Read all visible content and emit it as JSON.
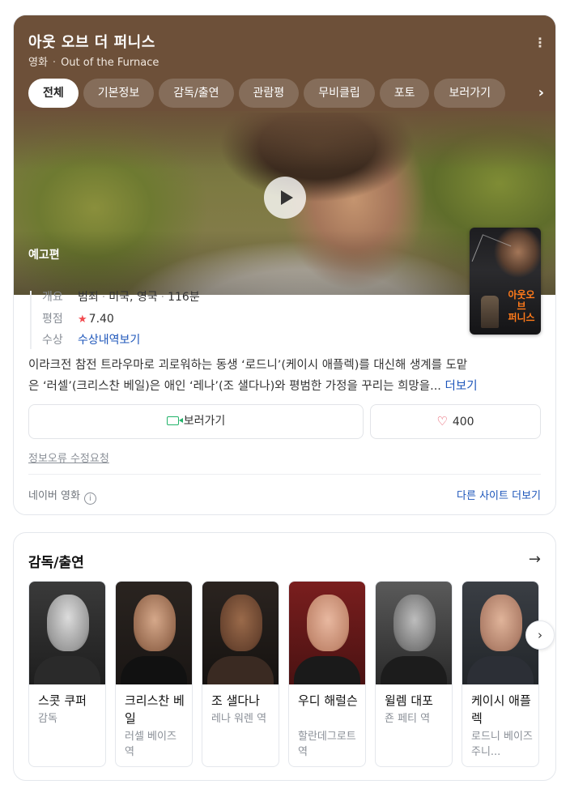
{
  "movie": {
    "title": "아웃 오브 더 퍼니스",
    "category": "영화",
    "original_title": "Out of the Furnace",
    "more_icon": "vertical-ellipsis-icon"
  },
  "tabs": [
    {
      "label": "전체",
      "active": true
    },
    {
      "label": "기본정보",
      "active": false
    },
    {
      "label": "감독/출연",
      "active": false
    },
    {
      "label": "관람평",
      "active": false
    },
    {
      "label": "무비클립",
      "active": false
    },
    {
      "label": "포토",
      "active": false
    },
    {
      "label": "보러가기",
      "active": false
    }
  ],
  "trailer": {
    "label": "예고편"
  },
  "info": {
    "overview_label": "개요",
    "genre": "범죄",
    "country": "미국, 영국",
    "runtime": "116분",
    "rating_label": "평점",
    "rating": "7.40",
    "awards_label": "수상",
    "awards_link": "수상내역보기"
  },
  "synopsis": {
    "line1": "이라크전 참전 트라우마로 괴로워하는 동생 ‘로드니’(케이시 애플렉)를 대신해 생계를 도맡",
    "line2": "은 ‘러셀’(크리스찬 베일)은 애인 ‘레나’(조 샐다나)와 평범한 가정을 꾸리는 희망을...",
    "more": "더보기"
  },
  "actions": {
    "watch_label": "보러가기",
    "like_count": "400"
  },
  "footer": {
    "report": "정보오류 수정요청",
    "source": "네이버 영화",
    "other_sites": "다른 사이트 더보기"
  },
  "cast": {
    "title": "감독/출연",
    "people": [
      {
        "name": "스콧 쿠퍼",
        "role": "감독"
      },
      {
        "name": "크리스찬 베일",
        "role": "러셀 베이즈 역"
      },
      {
        "name": "조 샐다나",
        "role": "레나 워렌 역"
      },
      {
        "name": "우디 해럴슨",
        "role": "할란데그로트 역"
      },
      {
        "name": "윌렘 대포",
        "role": "죤 페티 역"
      },
      {
        "name": "케이시 애플렉",
        "role": "로드니 베이즈 주니..."
      }
    ]
  },
  "colors": {
    "hero_brown": "#6d5039",
    "link_blue": "#1c55ba",
    "star_red": "#f2494e",
    "camera_green": "#22b36a"
  }
}
